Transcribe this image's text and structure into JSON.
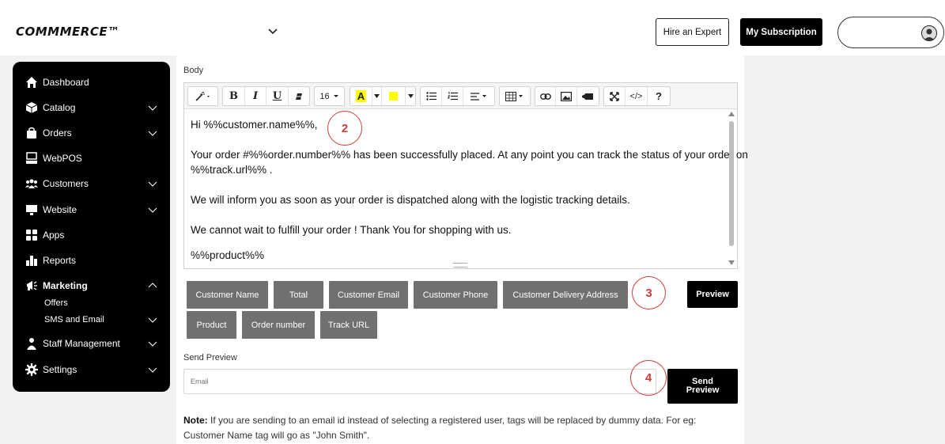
{
  "header": {
    "logo": "COMMMERCE™",
    "hire_expert": "Hire an Expert",
    "subscription": "My Subscription"
  },
  "sidebar": {
    "items": [
      {
        "label": "Dashboard",
        "icon": "home-icon"
      },
      {
        "label": "Catalog",
        "icon": "box-icon",
        "expandable": true
      },
      {
        "label": "Orders",
        "icon": "bag-icon",
        "expandable": true
      },
      {
        "label": "WebPOS",
        "icon": "pos-icon"
      },
      {
        "label": "Customers",
        "icon": "users-icon",
        "expandable": true
      },
      {
        "label": "Website",
        "icon": "monitor-icon",
        "expandable": true
      },
      {
        "label": "Apps",
        "icon": "apps-icon"
      },
      {
        "label": "Reports",
        "icon": "bar-chart-icon"
      },
      {
        "label": "Marketing",
        "icon": "megaphone-icon",
        "expanded": true
      },
      {
        "label": "Staff Management",
        "icon": "staff-icon",
        "expandable": true
      },
      {
        "label": "Settings",
        "icon": "gear-icon",
        "expandable": true
      }
    ],
    "marketing_sub": [
      {
        "label": "Offers"
      },
      {
        "label": "SMS and Email",
        "expandable": true
      }
    ]
  },
  "editor": {
    "label": "Body",
    "font_size": "16",
    "lines": [
      "Hi %%customer.name%%,",
      "Your order #%%order.number%% has been successfully placed. At any point you can track the status of your order on",
      "%%track.url%% .",
      "We will inform you as soon as your order is dispatched along with the logistic tracking details.",
      "We cannot wait to fulfill your order ! Thank You for shopping with us.",
      "%%product%%"
    ],
    "toolbar": {
      "bold": "B",
      "italic": "I",
      "underline": "U",
      "text_color": "A",
      "code": "</>",
      "help": "?"
    },
    "highlight_color": "#ffff00"
  },
  "tags": [
    "Customer Name",
    "Total",
    "Customer Email",
    "Customer Phone",
    "Customer Delivery Address",
    "Product",
    "Order number",
    "Track URL"
  ],
  "preview_label": "Preview",
  "annotations": [
    "2",
    "3",
    "4"
  ],
  "send_preview": {
    "label": "Send Preview",
    "placeholder": "Email",
    "button_line1": "Send",
    "button_line2": "Preview"
  },
  "note": {
    "bold": "Note:",
    "text": " If you are sending to an email id instead of selecting a registered user, tags will be replaced by dummy data. For eg: Customer Name tag will go as \"John Smith\"."
  },
  "colors": {
    "accent": "#000000",
    "tag_bg": "#707070",
    "annotation": "#d23c3c"
  }
}
